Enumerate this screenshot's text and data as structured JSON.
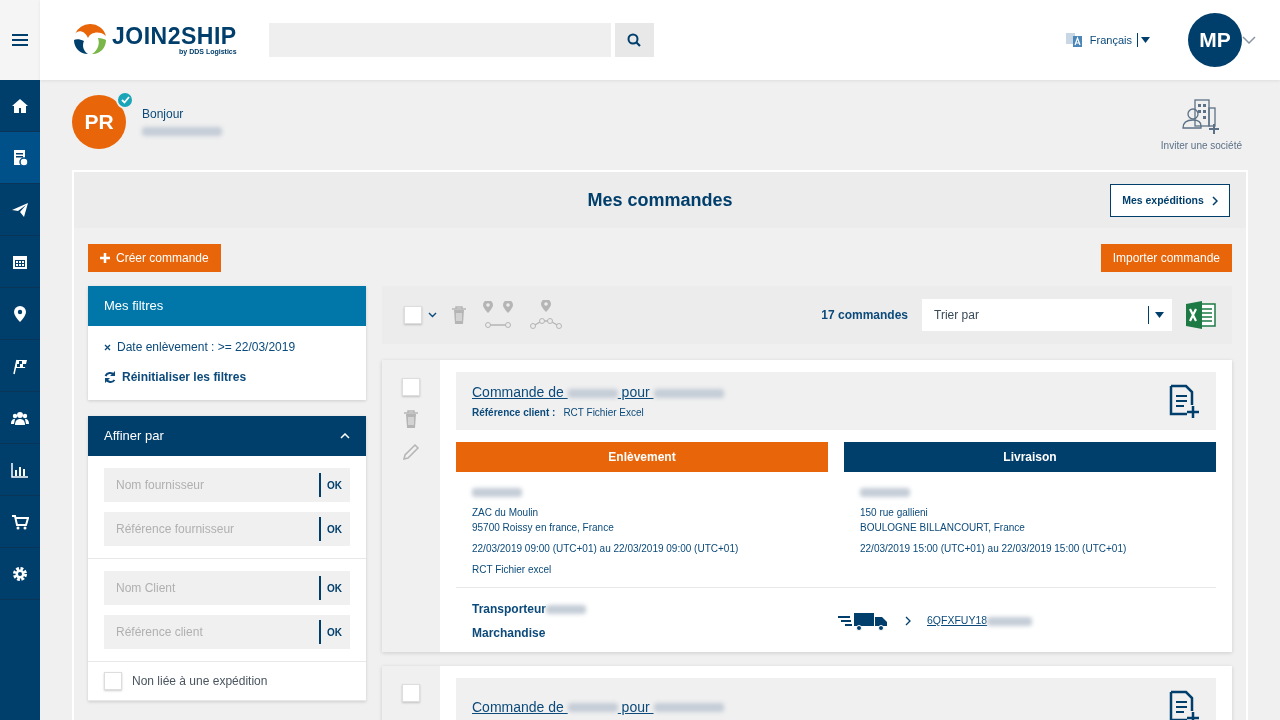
{
  "header": {
    "logo": {
      "name": "JOIN2SHIP",
      "tagline": "by DDS Logistics"
    },
    "language": "Français",
    "avatar": "MP"
  },
  "sidebar": {
    "items": [
      {
        "selected": false
      },
      {
        "selected": true
      },
      {
        "selected": false
      },
      {
        "selected": false
      },
      {
        "selected": false
      },
      {
        "selected": false
      },
      {
        "selected": false
      },
      {
        "selected": false
      },
      {
        "selected": false
      },
      {
        "selected": false
      }
    ]
  },
  "greeting": {
    "avatar": "PR",
    "verified": true,
    "hello": "Bonjour",
    "invite": "Inviter une société"
  },
  "page": {
    "title": "Mes commandes",
    "shipments_button": "Mes expéditions",
    "create_button": "Créer commande",
    "import_button": "Importer commande"
  },
  "filters": {
    "title": "Mes filtres",
    "active": [
      {
        "label": "Date enlèvement : >= 22/03/2019"
      }
    ],
    "reset": "Réinitialiser les filtres"
  },
  "refine": {
    "title": "Affiner par",
    "expanded": true,
    "groups": [
      {
        "kind": "fields",
        "fields": [
          {
            "placeholder": "Nom fournisseur",
            "button": "OK"
          },
          {
            "placeholder": "Référence fournisseur",
            "button": "OK"
          }
        ]
      },
      {
        "kind": "fields",
        "fields": [
          {
            "placeholder": "Nom Client",
            "button": "OK"
          },
          {
            "placeholder": "Référence client",
            "button": "OK"
          }
        ]
      },
      {
        "kind": "check",
        "label": "Non liée à une expédition",
        "checked": false
      }
    ]
  },
  "toolbar": {
    "count": "17 commandes",
    "sort": {
      "placeholder": "Trier par"
    }
  },
  "orders": [
    {
      "checked": false,
      "title_start": "Commande de",
      "title_mid": "pour",
      "ref_label": "Référence client :",
      "ref": "RCT Fichier Excel",
      "pickup": {
        "header": "Enlèvement",
        "address1": "ZAC du Moulin",
        "address2": "95700 Roissy en france, France",
        "dates": "22/03/2019 09:00 (UTC+01) au 22/03/2019 09:00 (UTC+01)",
        "note": "RCT Fichier excel"
      },
      "delivery": {
        "header": "Livraison",
        "address1": "150 rue gallieni",
        "address2": "BOULOGNE BILLANCOURT, France",
        "dates": "22/03/2019 15:00 (UTC+01) au 22/03/2019 15:00 (UTC+01)"
      },
      "carrier_label": "Transporteur",
      "goods_label": "Marchandise",
      "tracking": "6QFXFUY18"
    },
    {
      "checked": false,
      "title_start": "Commande de",
      "title_mid": "pour"
    }
  ]
}
